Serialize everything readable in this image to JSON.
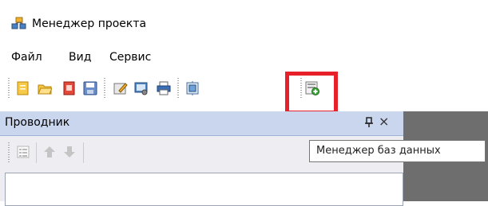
{
  "window": {
    "title": "Менеджер проекта",
    "app_icon": "project-network-icon"
  },
  "menu": {
    "items": [
      "Файл",
      "Вид",
      "Сервис"
    ]
  },
  "toolbar": {
    "buttons": [
      "new-project-icon",
      "open-folder-icon",
      "close-project-icon",
      "save-icon",
      "properties-icon",
      "settings-icon",
      "print-icon",
      "module-icon",
      "database-manager-icon"
    ],
    "highlighted_button": "database-manager-icon",
    "highlight_color": "#e8202a"
  },
  "explorer": {
    "title": "Проводник",
    "toolbar_buttons": [
      "list-view-icon",
      "arrow-up-icon",
      "arrow-down-icon"
    ]
  },
  "tooltip": {
    "text": "Менеджер баз данных"
  }
}
